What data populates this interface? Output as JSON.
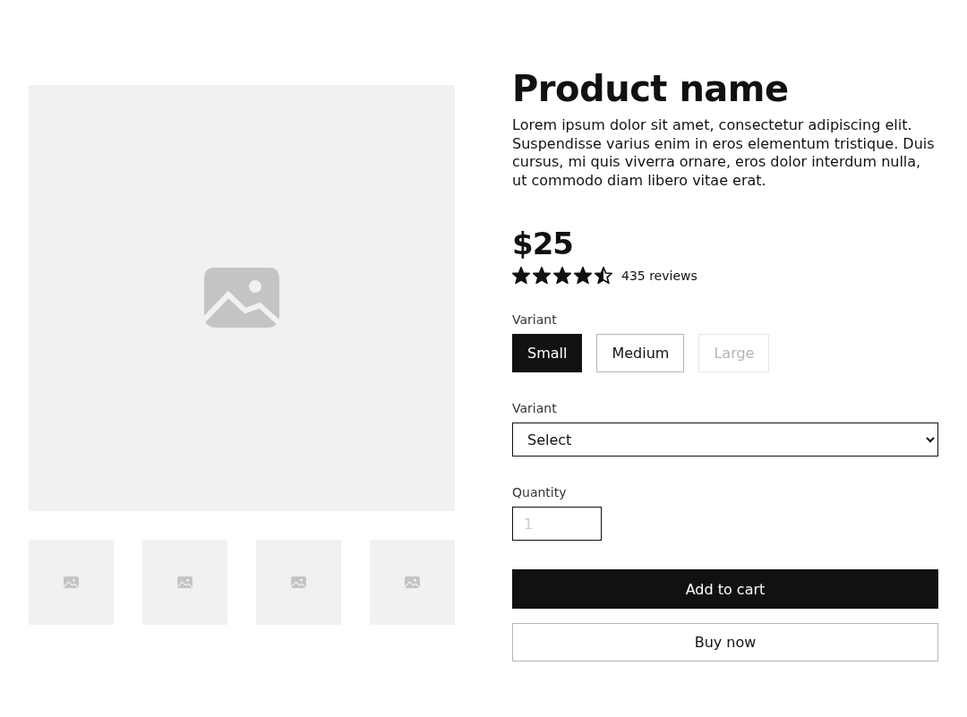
{
  "product": {
    "title": "Product name",
    "description": "Lorem ipsum dolor sit amet, consectetur adipiscing elit. Suspendisse varius enim in eros elementum tristique. Duis cursus, mi quis viverra ornare, eros dolor interdum nulla, ut commodo diam libero vitae erat.",
    "price": "$25",
    "stars": 4.5,
    "reviews": "435 reviews"
  },
  "gallery": {
    "thumbnails": [
      {
        "kind": "placeholder"
      },
      {
        "kind": "placeholder"
      },
      {
        "kind": "placeholder"
      },
      {
        "kind": "placeholder"
      }
    ]
  },
  "variant_buttons": {
    "label": "Variant",
    "options": [
      {
        "label": "Small",
        "selected": true,
        "disabled": false
      },
      {
        "label": "Medium",
        "selected": false,
        "disabled": false
      },
      {
        "label": "Large",
        "selected": false,
        "disabled": true
      }
    ]
  },
  "variant_select": {
    "label": "Variant",
    "value": "Select"
  },
  "quantity": {
    "label": "Quantity",
    "placeholder": "1"
  },
  "actions": [
    {
      "label": "Add to cart",
      "kind": "primary"
    },
    {
      "label": "Buy now",
      "kind": "secondary"
    }
  ]
}
